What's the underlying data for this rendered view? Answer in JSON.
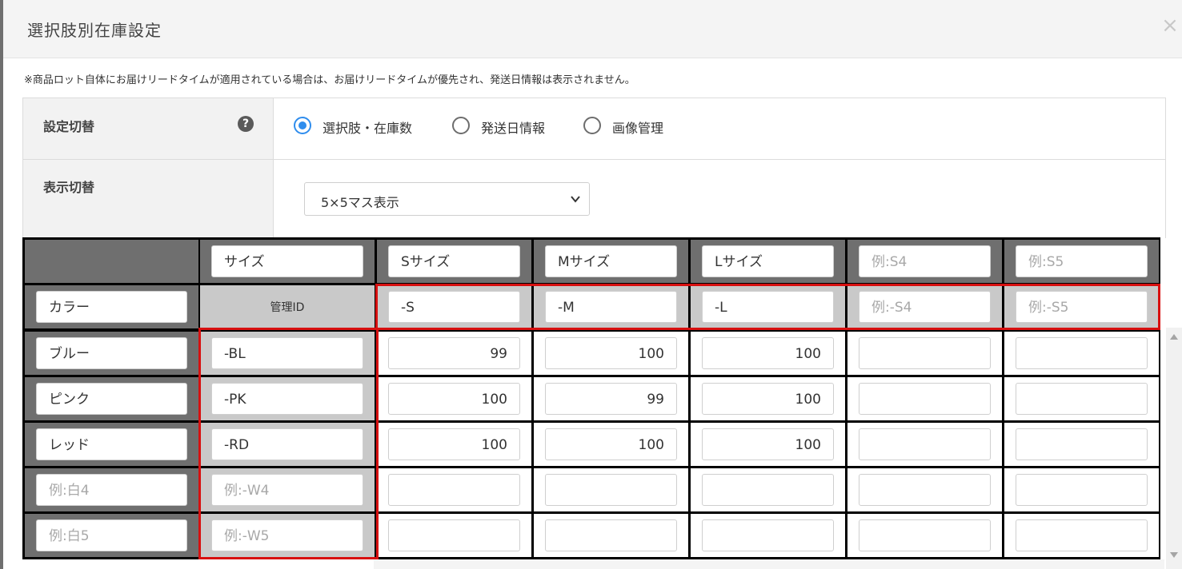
{
  "modal": {
    "title": "選択肢別在庫設定",
    "close_icon": "×"
  },
  "notice": "※商品ロット自体にお届けリードタイムが適用されている場合は、お届けリードタイムが優先され、発送日情報は表示されません。",
  "settings": {
    "switch_label": "設定切替",
    "help_icon_glyph": "?",
    "radios": [
      {
        "label": "選択肢・在庫数",
        "checked": true
      },
      {
        "label": "発送日情報",
        "checked": false
      },
      {
        "label": "画像管理",
        "checked": false
      }
    ],
    "display_label": "表示切替",
    "display_select_value": "5×5マス表示"
  },
  "grid": {
    "size_axis_label": "サイズ",
    "color_axis_label": "カラー",
    "admin_id_label": "管理ID",
    "columns": [
      {
        "name": "Sサイズ",
        "name_ph": false,
        "suffix": "-S",
        "suffix_ph": false
      },
      {
        "name": "Mサイズ",
        "name_ph": false,
        "suffix": "-M",
        "suffix_ph": false
      },
      {
        "name": "Lサイズ",
        "name_ph": false,
        "suffix": "-L",
        "suffix_ph": false
      },
      {
        "name": "例:S4",
        "name_ph": true,
        "suffix": "例:-S4",
        "suffix_ph": true
      },
      {
        "name": "例:S5",
        "name_ph": true,
        "suffix": "例:-S5",
        "suffix_ph": true
      }
    ],
    "rows": [
      {
        "name": "ブルー",
        "name_ph": false,
        "suffix": "-BL",
        "suffix_ph": false,
        "stock": [
          "99",
          "100",
          "100",
          "",
          ""
        ]
      },
      {
        "name": "ピンク",
        "name_ph": false,
        "suffix": "-PK",
        "suffix_ph": false,
        "stock": [
          "100",
          "99",
          "100",
          "",
          ""
        ]
      },
      {
        "name": "レッド",
        "name_ph": false,
        "suffix": "-RD",
        "suffix_ph": false,
        "stock": [
          "100",
          "100",
          "100",
          "",
          ""
        ]
      },
      {
        "name": "例:白4",
        "name_ph": true,
        "suffix": "例:-W4",
        "suffix_ph": true,
        "stock": [
          "",
          "",
          "",
          "",
          ""
        ]
      },
      {
        "name": "例:白5",
        "name_ph": true,
        "suffix": "例:-W5",
        "suffix_ph": true,
        "stock": [
          "",
          "",
          "",
          "",
          ""
        ]
      }
    ]
  },
  "colors": {
    "highlight_border": "#d81010",
    "radio_accent": "#2f8ded"
  }
}
